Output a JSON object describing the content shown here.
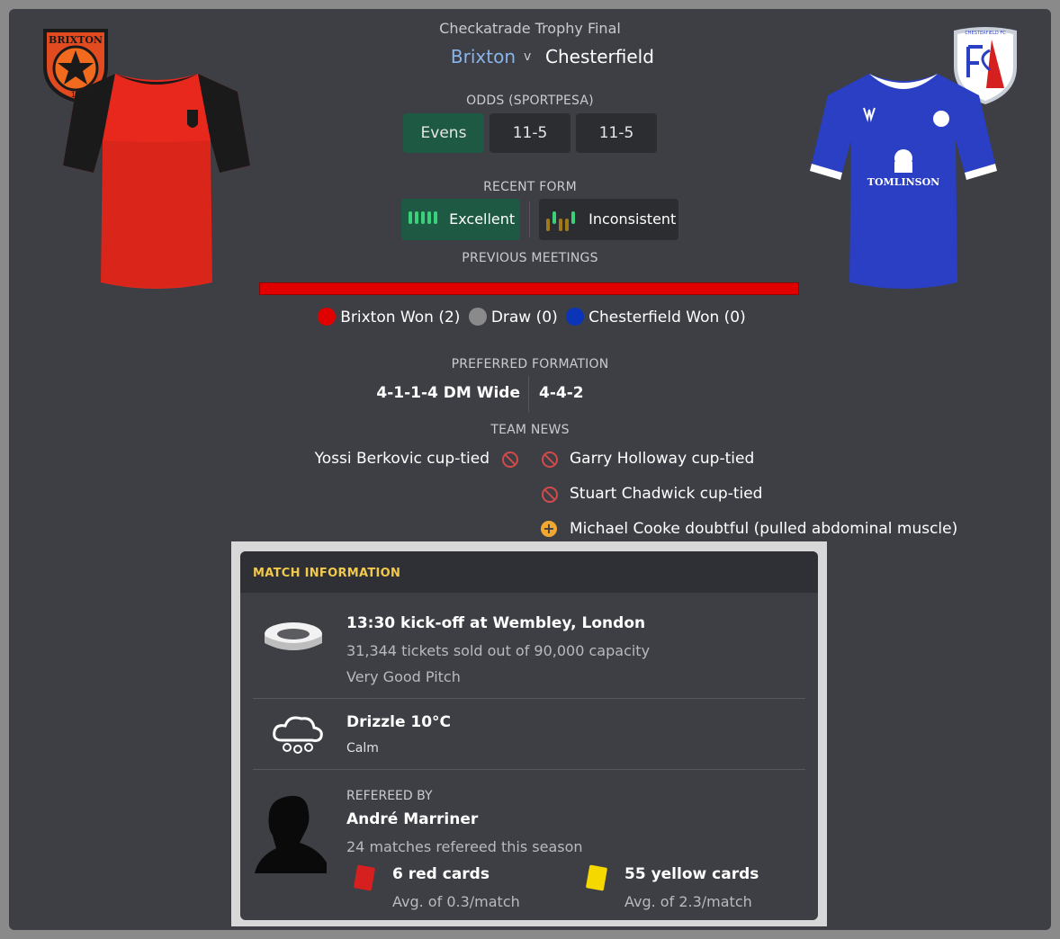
{
  "competition": "Checkatrade Trophy Final",
  "home_team": "Brixton",
  "versus": "v",
  "away_team": "Chesterfield",
  "home_badge_text": "BRIXTON",
  "home_badge_sub": "11",
  "away_badge_text": "CHESTERFIELD FC",
  "away_sponsor": "TOMLINSON",
  "colors": {
    "home_shirt": "#e8281c",
    "home_sleeves": "#1a1a1a",
    "away_shirt": "#2a3fc4",
    "accent_green": "#1e5a43",
    "home_name": "#8ab4ea",
    "section_yellow": "#f2c94c"
  },
  "odds": {
    "title": "ODDS (SPORTPESA)",
    "home": "Evens",
    "draw": "11-5",
    "away": "11-5"
  },
  "form": {
    "title": "RECENT FORM",
    "home": "Excellent",
    "away": "Inconsistent"
  },
  "previous_meetings": {
    "title": "PREVIOUS MEETINGS",
    "home_won": "Brixton Won (2)",
    "draw": "Draw (0)",
    "away_won": "Chesterfield Won (0)",
    "home_share": 1.0
  },
  "formation": {
    "title": "PREFERRED FORMATION",
    "home": "4-1-1-4 DM Wide",
    "away": "4-4-2"
  },
  "team_news": {
    "title": "TEAM NEWS",
    "home": [
      "Yossi Berkovic cup-tied"
    ],
    "away": [
      "Garry Holloway cup-tied",
      "Stuart Chadwick cup-tied",
      "Michael Cooke doubtful (pulled abdominal muscle)"
    ]
  },
  "match_info": {
    "title": "MATCH INFORMATION",
    "kickoff": "13:30 kick-off at Wembley, London",
    "tickets": "31,344 tickets sold out of 90,000 capacity",
    "pitch": "Very Good Pitch",
    "weather": "Drizzle 10°C",
    "wind": "Calm",
    "referee_label": "REFEREED BY",
    "referee": "André Marriner",
    "ref_matches": "24 matches refereed this season",
    "red_cards": "6 red cards",
    "red_avg": "Avg. of 0.3/match",
    "yellow_cards": "55 yellow cards",
    "yellow_avg": "Avg. of 2.3/match"
  }
}
